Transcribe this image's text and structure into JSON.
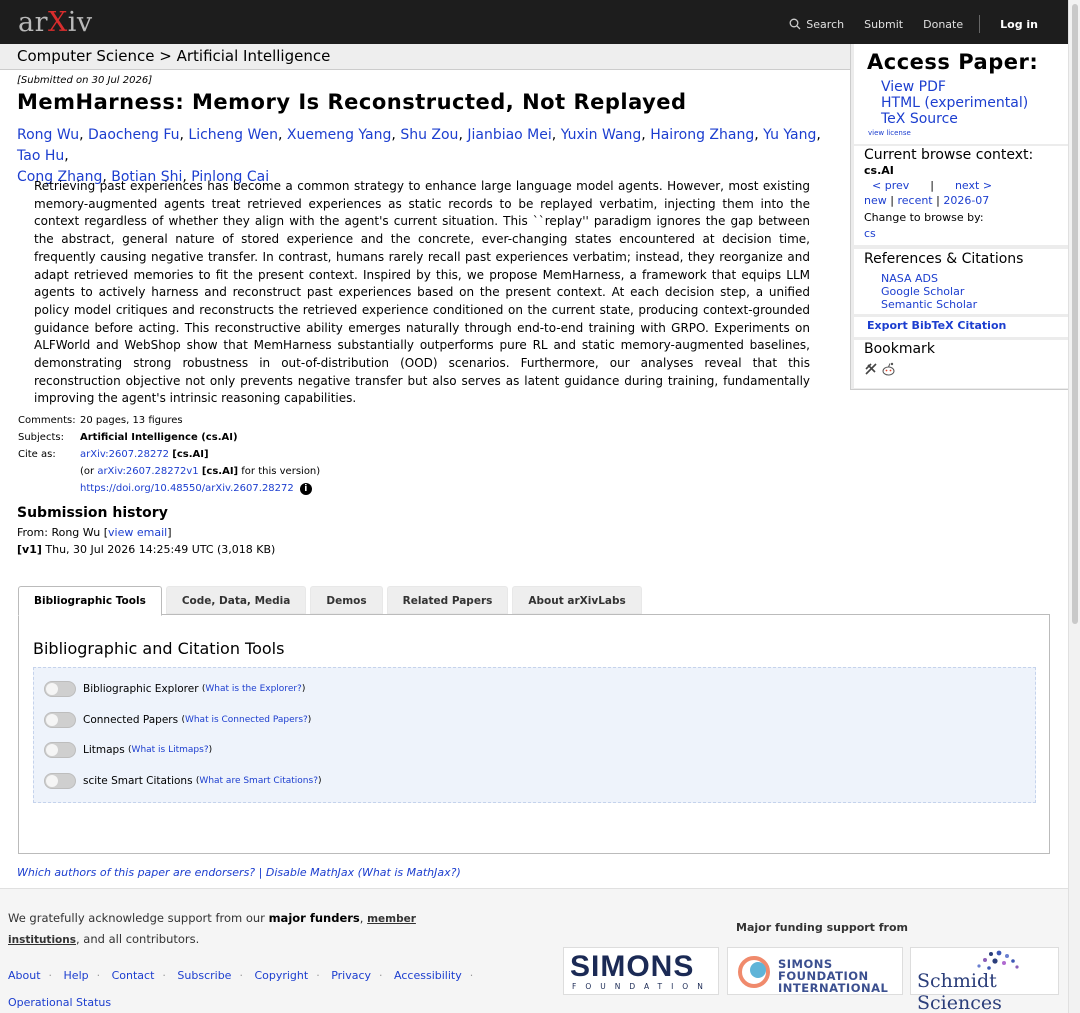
{
  "topbar": {
    "logo_pre": "ar",
    "logo_x": "X",
    "logo_post": "iv",
    "search": "Search",
    "submit": "Submit",
    "donate": "Donate",
    "login": "Log in"
  },
  "breadcrumb": "Computer Science > Artificial Intelligence",
  "paper": {
    "submitted": "[Submitted on 30 Jul 2026]",
    "title": "MemHarness: Memory Is Reconstructed, Not Replayed",
    "authors": [
      "Rong Wu",
      "Daocheng Fu",
      "Licheng Wen",
      "Xuemeng Yang",
      "Shu Zou",
      "Jianbiao Mei",
      "Yuxin Wang",
      "Hairong Zhang",
      "Yu Yang",
      "Tao Hu",
      "Cong Zhang",
      "Botian Shi",
      "Pinlong Cai"
    ],
    "abstract": "Retrieving past experiences has become a common strategy to enhance large language model agents. However, most existing memory-augmented agents treat retrieved experiences as static records to be replayed verbatim, injecting them into the context regardless of whether they align with the agent's current situation. This ``replay'' paradigm ignores the gap between the abstract, general nature of stored experience and the concrete, ever-changing states encountered at decision time, frequently causing negative transfer. In contrast, humans rarely recall past experiences verbatim; instead, they reorganize and adapt retrieved memories to fit the present context. Inspired by this, we propose MemHarness, a framework that equips LLM agents to actively harness and reconstruct past experiences based on the present context. At each decision step, a unified policy model critiques and reconstructs the retrieved experience conditioned on the current state, producing context-grounded guidance before acting. This reconstructive ability emerges naturally through end-to-end training with GRPO. Experiments on ALFWorld and WebShop show that MemHarness substantially outperforms pure RL and static memory-augmented baselines, demonstrating strong robustness in out-of-distribution (OOD) scenarios. Furthermore, our analyses reveal that this reconstruction objective not only prevents negative transfer but also serves as latent guidance during training, fundamentally improving the agent's intrinsic reasoning capabilities."
  },
  "meta": {
    "comments_label": "Comments:",
    "comments": "20 pages, 13 figures",
    "subjects_label": "Subjects:",
    "subjects": "Artificial Intelligence (cs.AI)",
    "cite_label": "Cite as:",
    "cite_id": "arXiv:2607.28272",
    "cite_cat": "[cs.AI]",
    "or_pre": "(or ",
    "cite_v": "arXiv:2607.28272v1",
    "cite_v_cat": "[cs.AI]",
    "or_post": " for this version)",
    "doi": "https://doi.org/10.48550/arXiv.2607.28272"
  },
  "history": {
    "heading": "Submission history",
    "from_pre": "From: Rong Wu [",
    "view_email": "view email",
    "from_post": "]",
    "version": "[v1]",
    "version_text": " Thu, 30 Jul 2026 14:25:49 UTC (3,018 KB)"
  },
  "tabs": [
    "Bibliographic Tools",
    "Code, Data, Media",
    "Demos",
    "Related Papers",
    "About arXivLabs"
  ],
  "panel": {
    "heading": "Bibliographic and Citation Tools",
    "tools": [
      {
        "label": "Bibliographic Explorer",
        "help": "What is the Explorer?"
      },
      {
        "label": "Connected Papers",
        "help": "What is Connected Papers?"
      },
      {
        "label": "Litmaps",
        "help": "What is Litmaps?"
      },
      {
        "label": "scite Smart Citations",
        "help": "What are Smart Citations?"
      }
    ]
  },
  "endorsers": "Which authors of this paper are endorsers? | Disable MathJax (What is MathJax?)",
  "sidebar": {
    "access_heading": "Access Paper:",
    "view_pdf": "View PDF",
    "html": "HTML (experimental)",
    "tex": "TeX Source",
    "view_license": "view license",
    "browse_heading": "Current browse context:",
    "browse_cat": "cs.AI",
    "prev": "< prev",
    "bar": "|",
    "next": "next >",
    "new": "new",
    "recent": "recent",
    "month": "2026-07",
    "change_by": "Change to browse by:",
    "cs": "cs",
    "refs_heading": "References & Citations",
    "nasa": "NASA ADS",
    "google": "Google Scholar",
    "semantic": "Semantic Scholar",
    "export": "Export BibTeX Citation",
    "bookmark_heading": "Bookmark"
  },
  "footer": {
    "ack_pre": "We gratefully acknowledge support from our ",
    "major_funders": "major funders",
    "comma": ", ",
    "member": "member institutions",
    "ack_post": ", and all contributors.",
    "links": [
      "About",
      "Help",
      "Contact",
      "Subscribe",
      "Copyright",
      "Privacy",
      "Accessibility",
      "Operational Status"
    ],
    "funding_heading": "Major funding support from",
    "simons_big": "SIMONS",
    "simons_small": "FOUNDATION",
    "sfi_line1": "SIMONS",
    "sfi_line2": "FOUNDATION",
    "sfi_line3": "INTERNATIONAL",
    "schmidt": "Schmidt Sciences"
  },
  "colors": {
    "link": "#1c3ecf",
    "topbar": "#1d1d1d",
    "logo_x": "#d92d2d"
  }
}
